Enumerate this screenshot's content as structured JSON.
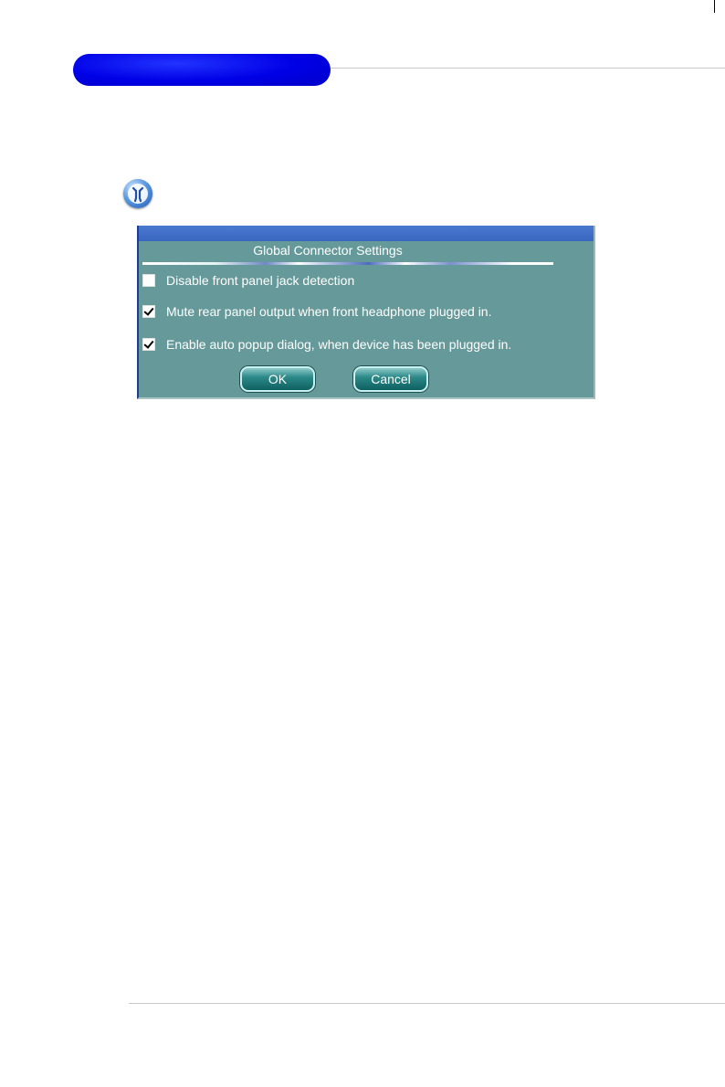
{
  "dialog": {
    "title": "Global Connector Settings",
    "options": [
      {
        "label": "Disable front panel jack detection",
        "checked": false
      },
      {
        "label": "Mute rear panel output when front headphone plugged in.",
        "checked": true
      },
      {
        "label": "Enable auto popup dialog, when device has been plugged in.",
        "checked": true
      }
    ],
    "ok_label": "OK",
    "cancel_label": "Cancel"
  },
  "icons": {
    "tool": "wrench-icon"
  },
  "colors": {
    "header_pill": "#0000e6",
    "dialog_bg": "#669999",
    "titlebar": "#3a66c0"
  }
}
